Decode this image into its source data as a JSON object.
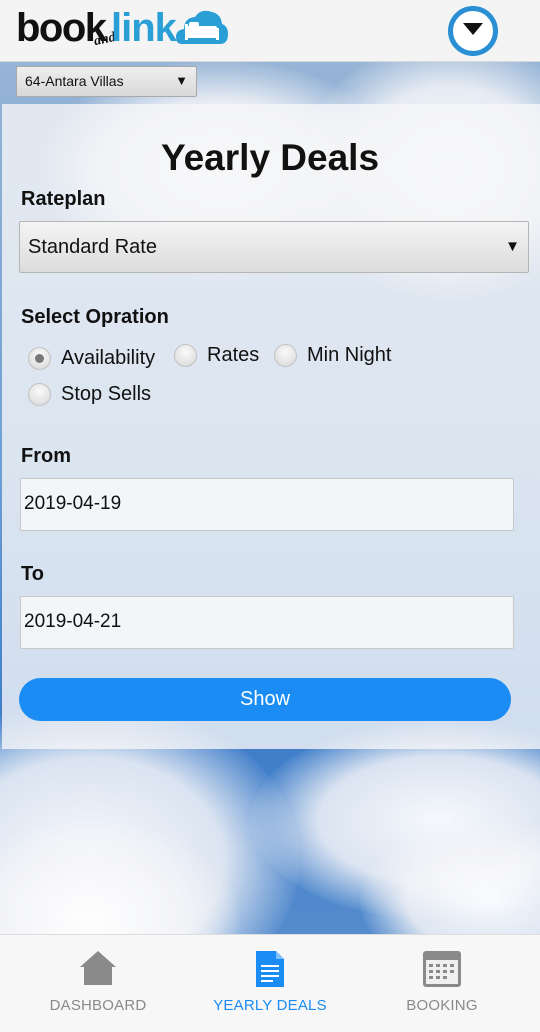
{
  "header": {
    "logo_book": "book",
    "logo_and": "and",
    "logo_link": "link"
  },
  "property": {
    "selected": "64-Antara Villas"
  },
  "page": {
    "title": "Yearly Deals"
  },
  "rateplan": {
    "label": "Rateplan",
    "selected": "Standard Rate"
  },
  "operation": {
    "label": "Select Opration",
    "options": [
      {
        "label": "Availability",
        "checked": true
      },
      {
        "label": "Rates",
        "checked": false
      },
      {
        "label": "Min Night",
        "checked": false
      },
      {
        "label": "Stop Sells",
        "checked": false
      }
    ]
  },
  "from": {
    "label": "From",
    "value": "2019-04-19"
  },
  "to": {
    "label": "To",
    "value": "2019-04-21"
  },
  "actions": {
    "show_label": "Show"
  },
  "nav": {
    "items": [
      {
        "label": "DASHBOARD",
        "icon": "home-icon",
        "active": false
      },
      {
        "label": "YEARLY DEALS",
        "icon": "document-icon",
        "active": true
      },
      {
        "label": "BOOKING",
        "icon": "calendar-icon",
        "active": false
      }
    ]
  },
  "colors": {
    "accent": "#1a8cf3",
    "logo_blue": "#2a9fd6",
    "nav_inactive": "#8a8a8a",
    "nav_active": "#1a8cf3"
  }
}
